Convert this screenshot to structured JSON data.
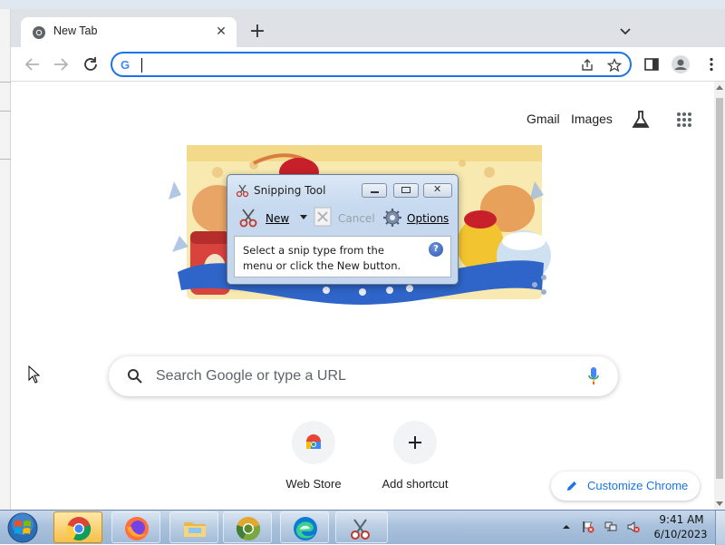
{
  "browser": {
    "tab": {
      "title": "New Tab"
    },
    "omnibox": {
      "value": "",
      "placeholder": ""
    }
  },
  "ntp": {
    "links": {
      "gmail": "Gmail",
      "images": "Images"
    },
    "search": {
      "placeholder": "Search Google or type a URL"
    },
    "shortcuts": [
      {
        "label": "Web Store"
      },
      {
        "label": "Add shortcut"
      }
    ],
    "customize_label": "Customize Chrome"
  },
  "snipping_tool": {
    "title": "Snipping Tool",
    "new_label": "New",
    "cancel_label": "Cancel",
    "options_label": "Options",
    "message": "Select a snip type from the menu or click the New button.",
    "help_symbol": "?"
  },
  "taskbar": {
    "apps": [
      "chrome",
      "firefox",
      "file-explorer",
      "chrome-canary",
      "edge",
      "snipping-tool"
    ],
    "time": "9:41 AM",
    "date": "6/10/2023"
  },
  "colors": {
    "accent": "#1a73e8",
    "tabstrip": "#dee1e6",
    "taskbar": "#a9c1dc"
  }
}
